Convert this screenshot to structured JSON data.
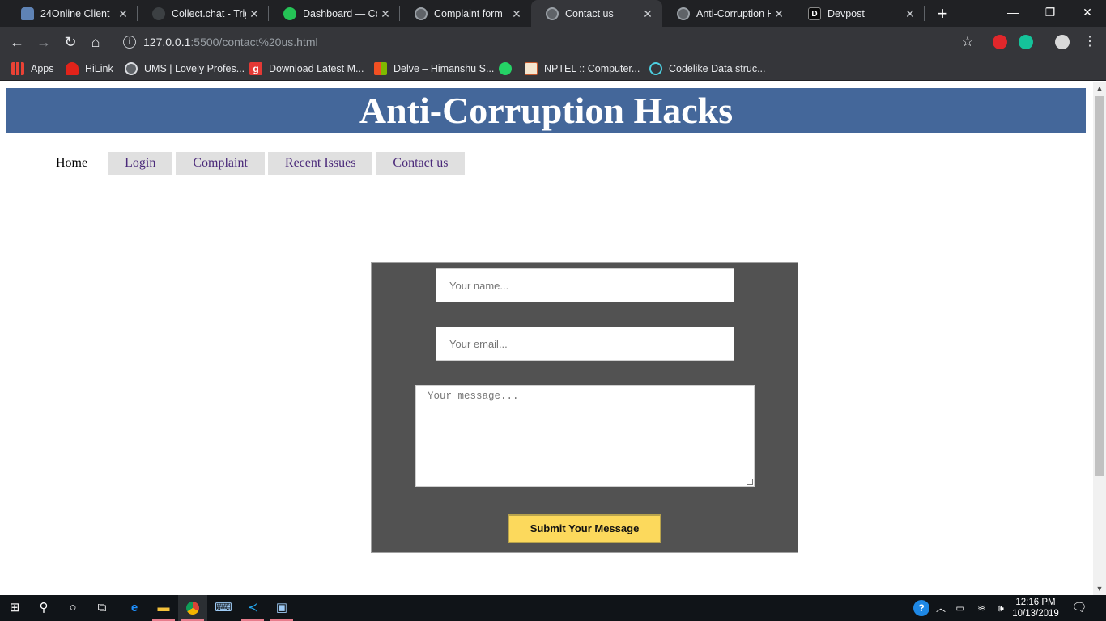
{
  "browser": {
    "tabs": [
      {
        "title": "24Online Client",
        "icon": "cloud-icon",
        "color": "#5f83b5"
      },
      {
        "title": "Collect.chat - Trigg",
        "icon": "chat-icon",
        "color": "#3c4043"
      },
      {
        "title": "Dashboard — Coll",
        "icon": "chat-bubble-icon",
        "color": "#25c356"
      },
      {
        "title": "Complaint form",
        "icon": "globe-icon",
        "color": "#5f6368"
      },
      {
        "title": "Contact us",
        "icon": "globe-icon",
        "color": "#5f6368"
      },
      {
        "title": "Anti-Corruption H",
        "icon": "globe-icon",
        "color": "#5f6368"
      },
      {
        "title": "Devpost",
        "icon": "devpost-icon",
        "color": "#0a0a0a",
        "letter": "D"
      }
    ],
    "active_tab": 4,
    "address": {
      "host": "127.0.0.1",
      "path": ":5500/contact%20us.html"
    },
    "bookmarks": [
      {
        "label": "Apps",
        "icon": "apps-grid-icon"
      },
      {
        "label": "HiLink",
        "icon": "huawei-icon"
      },
      {
        "label": "UMS | Lovely Profes...",
        "icon": "globe-icon"
      },
      {
        "label": "Download Latest M...",
        "icon": "g-icon",
        "letter": "g"
      },
      {
        "label": "Delve – Himanshu S...",
        "icon": "microsoft-icon"
      },
      {
        "label": "",
        "icon": "whatsapp-icon"
      },
      {
        "label": "NPTEL :: Computer...",
        "icon": "nptel-icon"
      },
      {
        "label": "Codelike Data struc...",
        "icon": "circle-icon"
      }
    ]
  },
  "page": {
    "banner_title": "Anti-Corruption Hacks",
    "nav": [
      "Home",
      "Login",
      "Complaint",
      "Recent Issues",
      "Contact us"
    ],
    "form": {
      "name_placeholder": "Your name...",
      "email_placeholder": "Your email...",
      "message_placeholder": "Your message...",
      "submit_label": "Submit Your Message"
    }
  },
  "taskbar": {
    "time": "12:16 PM",
    "date": "10/13/2019"
  },
  "colors": {
    "banner": "#44679a",
    "form_bg": "#525252",
    "submit_bg": "#fcd95c",
    "nav_link": "#4b2a7a"
  }
}
